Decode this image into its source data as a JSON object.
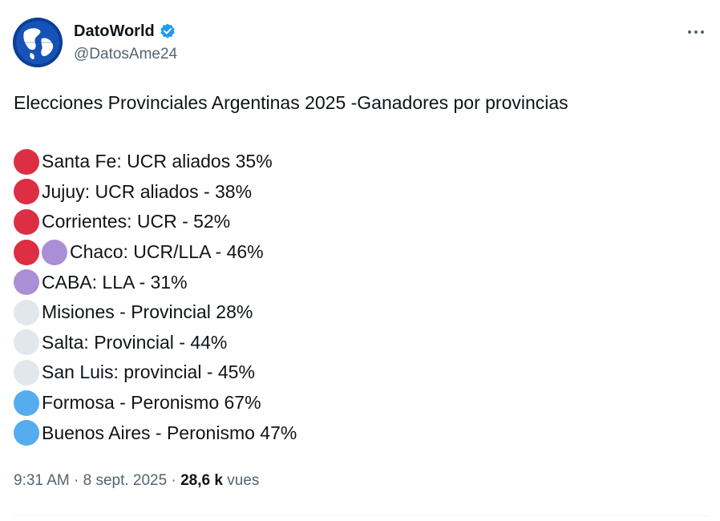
{
  "author": {
    "display_name": "DatoWorld",
    "handle": "@DatosAme24",
    "verified": true
  },
  "tweet": {
    "title": "Elecciones Provinciales Argentinas 2025 -Ganadores por provincias",
    "results": [
      {
        "text": "Santa Fe: UCR aliados 35%",
        "dots": [
          "red"
        ]
      },
      {
        "text": "Jujuy: UCR aliados - 38%",
        "dots": [
          "red"
        ]
      },
      {
        "text": "Corrientes: UCR - 52%",
        "dots": [
          "red"
        ]
      },
      {
        "text": "Chaco: UCR/LLA - 46%",
        "dots": [
          "red",
          "purple"
        ]
      },
      {
        "text": "CABA: LLA - 31%",
        "dots": [
          "purple"
        ]
      },
      {
        "text": "Misiones - Provincial 28%",
        "dots": [
          "white"
        ]
      },
      {
        "text": "Salta: Provincial - 44%",
        "dots": [
          "white"
        ]
      },
      {
        "text": "San Luis: provincial - 45%",
        "dots": [
          "white"
        ]
      },
      {
        "text": "Formosa - Peronismo 67%",
        "dots": [
          "blue"
        ]
      },
      {
        "text": "Buenos Aires - Peronismo 47%",
        "dots": [
          "blue"
        ]
      }
    ]
  },
  "meta": {
    "time": "9:31 AM",
    "separator": "·",
    "date": "8 sept. 2025",
    "views_count": "28,6 k",
    "views_label": "vues"
  },
  "colors": {
    "red": "#dd2e44",
    "purple": "#aa8ed6",
    "white": "#e1e8ed",
    "blue": "#55acee",
    "verified": "#1d9bf0",
    "secondary_text": "#536471"
  },
  "icons": {
    "avatar": "globe-avatar",
    "verified": "verified-badge-icon",
    "more": "more-dots-icon"
  }
}
